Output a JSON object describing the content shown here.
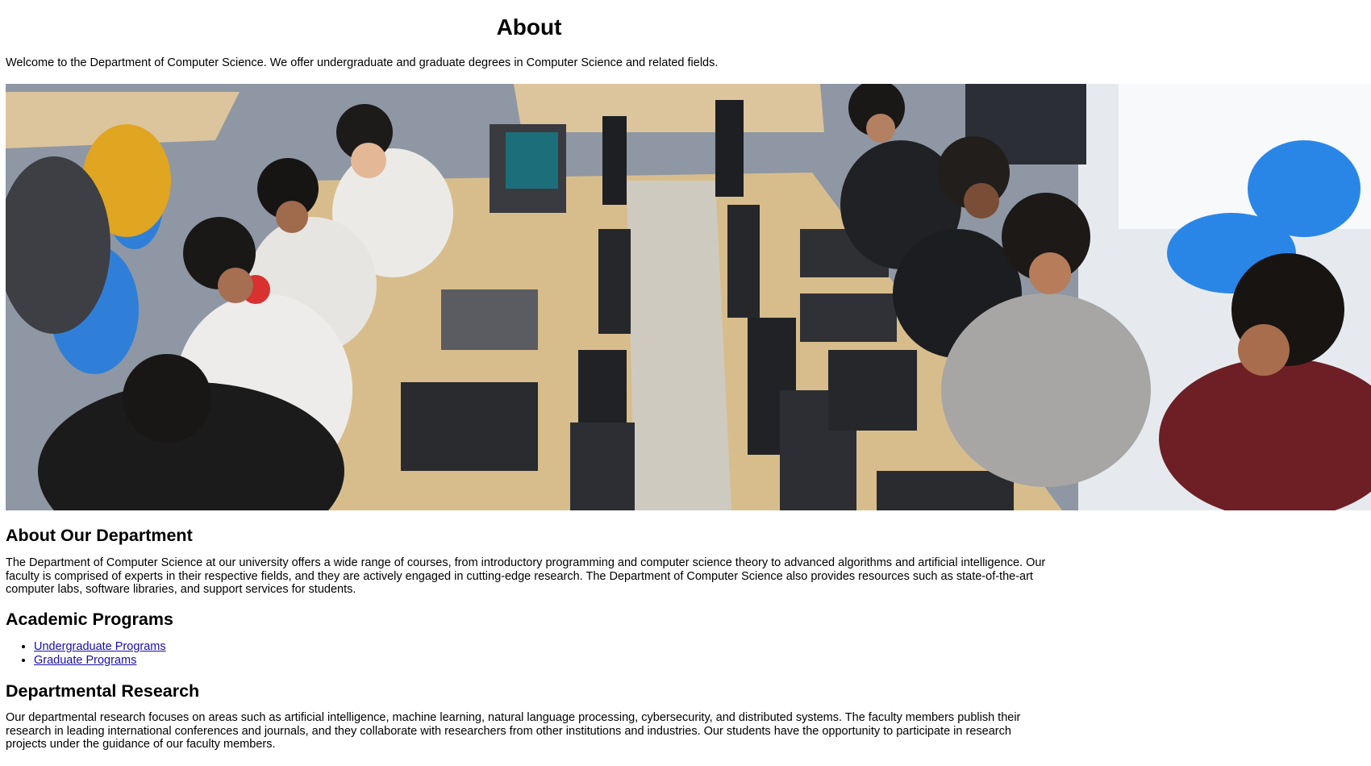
{
  "page": {
    "title": "About",
    "intro": "Welcome to the Department of Computer Science. We offer undergraduate and graduate degrees in Computer Science and related fields."
  },
  "hero_image": {
    "alt": "Students working at laptops and monitors in a computer lab"
  },
  "about": {
    "heading": "About Our Department",
    "text": "The Department of Computer Science at our university offers a wide range of courses, from introductory programming and computer science theory to advanced algorithms and artificial intelligence. Our faculty is comprised of experts in their respective fields, and they are actively engaged in cutting-edge research. The Department of Computer Science also provides resources such as state-of-the-art computer labs, software libraries, and support services for students."
  },
  "programs": {
    "heading": "Academic Programs",
    "links": [
      {
        "label": "Undergraduate Programs"
      },
      {
        "label": "Graduate Programs"
      }
    ]
  },
  "research": {
    "heading": "Departmental Research",
    "text": "Our departmental research focuses on areas such as artificial intelligence, machine learning, natural language processing, cybersecurity, and distributed systems. The faculty members publish their research in leading international conferences and journals, and they collaborate with researchers from other institutions and industries. Our students have the opportunity to participate in research projects under the guidance of our faculty members."
  },
  "colors": {
    "link": "#1a0dab",
    "text": "#000000",
    "background": "#ffffff"
  }
}
